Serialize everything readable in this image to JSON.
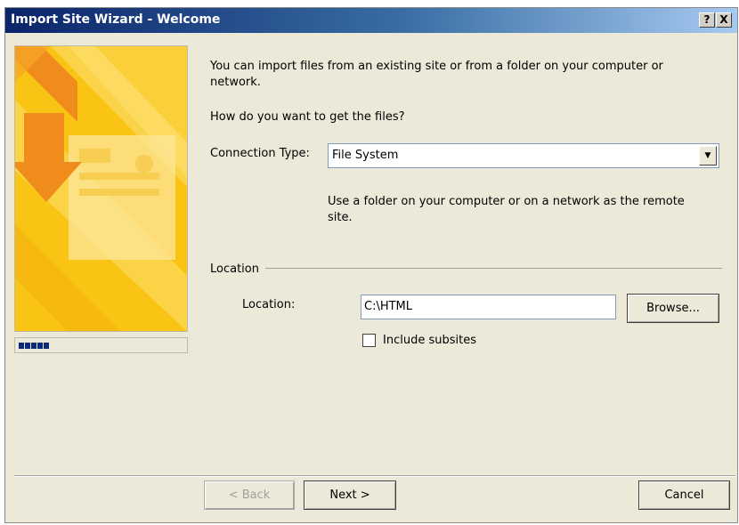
{
  "window": {
    "title": "Import Site Wizard - Welcome",
    "help_label": "?",
    "close_label": "X"
  },
  "intro": {
    "line1": "You can import files from an existing site or from a folder on your computer or",
    "line2": "network.",
    "question": "How do you want to get the files?"
  },
  "connection": {
    "label": "Connection Type:",
    "value": "File System",
    "desc_line1": "Use a folder on your computer or on a network as the remote",
    "desc_line2": "site."
  },
  "location": {
    "group_label": "Location",
    "field_label": "Location:",
    "value": "C:\\HTML",
    "browse_label": "Browse...",
    "include_subsites_label": "Include subsites",
    "include_subsites_checked": false
  },
  "progress": {
    "completed_fraction": 0.2
  },
  "buttons": {
    "back": "< Back",
    "next": "Next >",
    "cancel": "Cancel"
  },
  "colors": {
    "title_bar": "#0a246a",
    "panel_yellow": "#f9c414",
    "panel_orange": "#f08c1c",
    "progress_fill": "#0b2a7a"
  }
}
